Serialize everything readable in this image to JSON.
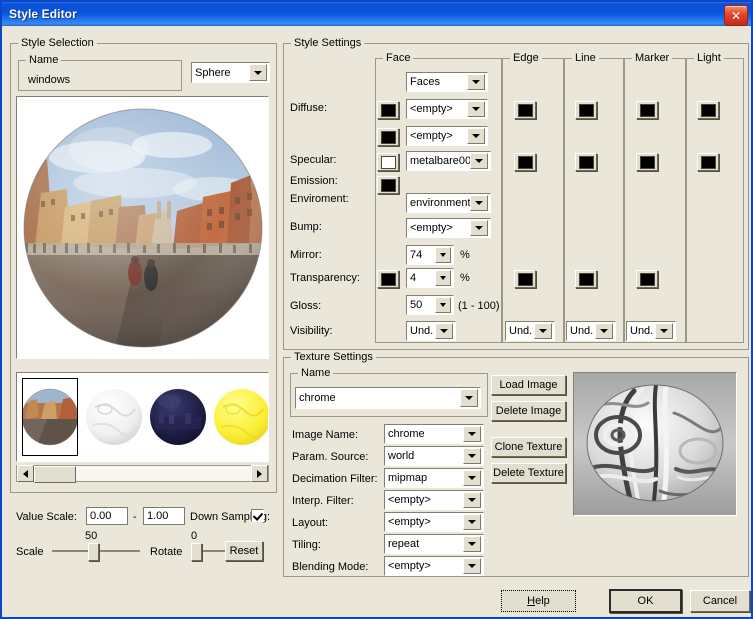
{
  "window": {
    "title": "Style Editor",
    "close_icon": "close-icon"
  },
  "style_selection": {
    "legend": "Style Selection",
    "name_legend": "Name",
    "name_value": "windows",
    "type_value": "Sphere"
  },
  "preview": {
    "alt": "chrome sphere reflecting a city square"
  },
  "thumbnails": [
    {
      "name": "chrome-city",
      "selected": true
    },
    {
      "name": "white-silver",
      "selected": false
    },
    {
      "name": "dark-navy",
      "selected": false
    },
    {
      "name": "yellow-gold",
      "selected": false
    }
  ],
  "bottom_controls": {
    "value_scale_label": "Value Scale:",
    "value_scale_min": "0.00",
    "value_scale_sep": "-",
    "value_scale_max": "1.00",
    "down_sampling_label": "Down Sampling:",
    "down_sampling_checked": true,
    "scale_label": "Scale",
    "scale_value": "50",
    "rotate_label": "Rotate",
    "rotate_value": "0",
    "reset_label": "Reset"
  },
  "style_settings": {
    "legend": "Style Settings",
    "row_labels": [
      "Diffuse:",
      "Specular:",
      "Emission:",
      "Enviroment:",
      "Bump:",
      "Mirror:",
      "Transparency:",
      "Gloss:",
      "Visibility:"
    ],
    "gloss_range": "(1 - 100)",
    "percent": "%",
    "columns": {
      "face": {
        "legend": "Face",
        "top_combo": "Faces",
        "diffuse_combo": "<empty>",
        "diffuse2_combo": "<empty>",
        "specular_combo": "metalbare00",
        "environment_combo": "environment",
        "bump_combo": "<empty>",
        "mirror_value": "74",
        "transparency_value": "4",
        "gloss_value": "50",
        "visibility_value": "Und.",
        "swatch_diffuse": "#000000",
        "swatch_diffuse2": "#000000",
        "swatch_specular": "#FFFFFF",
        "swatch_emission": "#000000",
        "swatch_transparency": "#000000"
      },
      "edge": {
        "legend": "Edge",
        "visibility_value": "Und.",
        "swatch_1": "#000000",
        "swatch_2": "#000000",
        "swatch_3": "#000000"
      },
      "line": {
        "legend": "Line",
        "visibility_value": "Und.",
        "swatch_1": "#000000",
        "swatch_2": "#000000",
        "swatch_3": "#000000"
      },
      "marker": {
        "legend": "Marker",
        "visibility_value": "Und.",
        "swatch_1": "#000000",
        "swatch_2": "#000000",
        "swatch_3": "#000000"
      },
      "light": {
        "legend": "Light",
        "swatch_1": "#000000",
        "swatch_2": "#000000"
      }
    }
  },
  "texture_settings": {
    "legend": "Texture Settings",
    "name_legend": "Name",
    "name_value": "chrome",
    "buttons": {
      "load_image": "Load Image",
      "delete_image": "Delete Image",
      "clone_texture": "Clone Texture",
      "delete_texture": "Delete Texture"
    },
    "rows": [
      {
        "label": "Image Name:",
        "value": "chrome"
      },
      {
        "label": "Param. Source:",
        "value": "world"
      },
      {
        "label": "Decimation Filter:",
        "value": "mipmap"
      },
      {
        "label": "Interp. Filter:",
        "value": "<empty>"
      },
      {
        "label": "Layout:",
        "value": "<empty>"
      },
      {
        "label": "Tiling:",
        "value": "repeat"
      },
      {
        "label": "Blending Mode:",
        "value": "<empty>"
      }
    ],
    "texture_preview_alt": "grayscale chrome texture"
  },
  "dialog_buttons": {
    "help": "Help",
    "ok": "OK",
    "cancel": "Cancel"
  },
  "colors": {
    "window_bg": "#EAE7DA",
    "titlebar_blue": "#0A53D8",
    "border": "#9C9886",
    "field_bg": "#FFFFFF"
  }
}
